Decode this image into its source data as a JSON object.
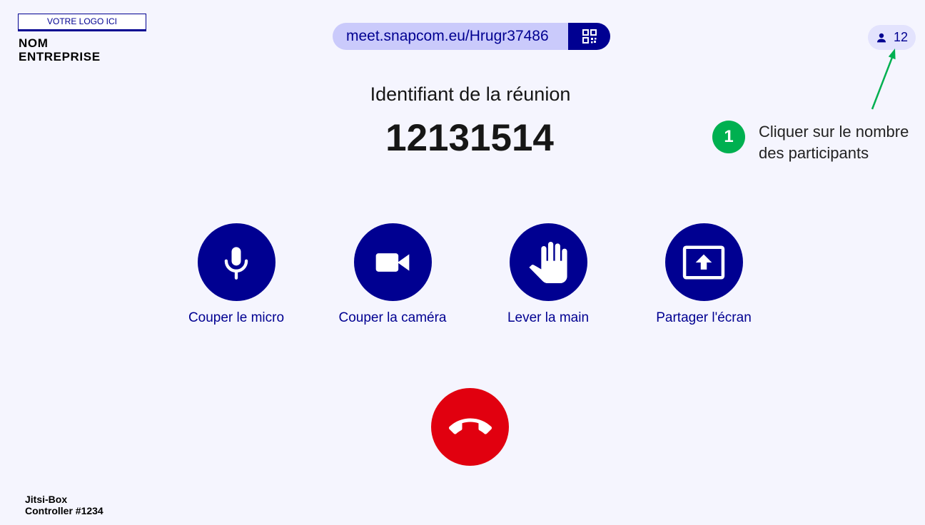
{
  "logo": {
    "placeholder": "VOTRE LOGO ICI",
    "company_line1": "NOM",
    "company_line2": "ENTREPRISE"
  },
  "meeting_link": {
    "url": "meet.snapcom.eu/Hrugr37486",
    "qr_button_icon": "qr-code-icon"
  },
  "participants": {
    "icon": "person-icon",
    "count": "12"
  },
  "meeting": {
    "id_label": "Identifiant de la réunion",
    "id": "12131514"
  },
  "controls": [
    {
      "label": "Couper le micro",
      "icon": "microphone-icon"
    },
    {
      "label": "Couper la caméra",
      "icon": "video-camera-icon"
    },
    {
      "label": "Lever la main",
      "icon": "raised-hand-icon"
    },
    {
      "label": "Partager l'écran",
      "icon": "share-screen-icon"
    }
  ],
  "hangup": {
    "icon": "phone-hangup-icon"
  },
  "annotation": {
    "step": "1",
    "text_line1": "Cliquer sur le nombre",
    "text_line2": "des participants"
  },
  "footer": {
    "line1": "Jitsi-Box",
    "line2": "Controller #1234"
  },
  "colors": {
    "background": "#f5f5fe",
    "primary": "#000091",
    "link_pill": "#cacafb",
    "participants_pill": "#e3e3fd",
    "hangup": "#e1000f",
    "annotation": "#00b050",
    "text": "#161616"
  }
}
